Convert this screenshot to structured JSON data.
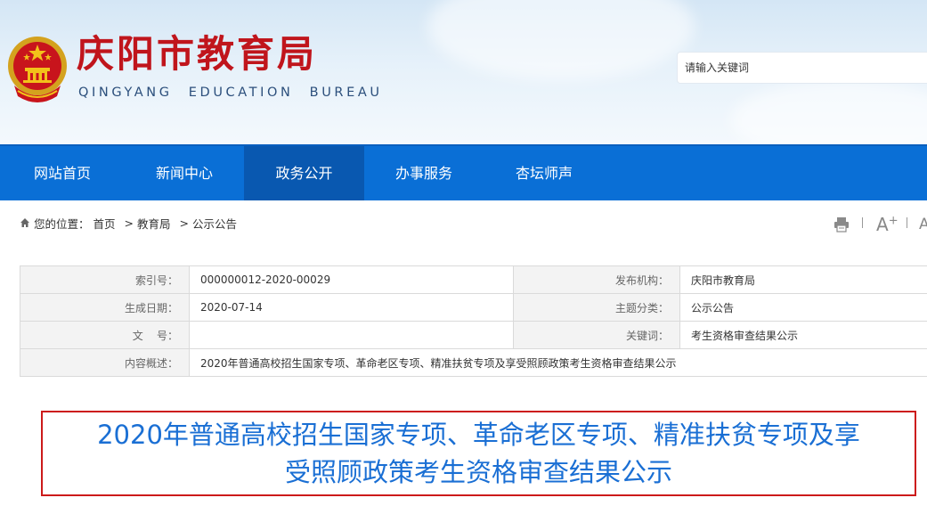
{
  "site": {
    "title": "庆阳市教育局",
    "subtitle": "QINGYANG EDUCATION BUREAU",
    "emblem_icon": "national-emblem-icon",
    "title_color": "#c0151c"
  },
  "search": {
    "placeholder": "请输入关键词"
  },
  "nav": {
    "items": [
      {
        "label": "网站首页"
      },
      {
        "label": "新闻中心"
      },
      {
        "label": "政务公开",
        "active": true
      },
      {
        "label": "办事服务"
      },
      {
        "label": "杏坛师声"
      }
    ],
    "color": "#0a6fd6",
    "active_color": "#0958b0"
  },
  "breadcrumb": {
    "home_icon": "home-icon",
    "prefix": "您的位置：",
    "items": [
      "首页",
      "教育局",
      "公示公告"
    ],
    "separator": ">"
  },
  "tools": {
    "print_icon": "print-icon",
    "font_large": "A",
    "font_large_sign": "+",
    "font_small": "A"
  },
  "meta": {
    "index_label": "索引号：",
    "index_value": "000000012-2020-00029",
    "publisher_label": "发布机构：",
    "publisher_value": "庆阳市教育局",
    "date_label": "生成日期：",
    "date_value": "2020-07-14",
    "category_label": "主题分类：",
    "category_value": "公示公告",
    "docno_label": "文    号：",
    "docno_value": "",
    "keywords_label": "关键词：",
    "keywords_value": "考生资格审查结果公示",
    "summary_label": "内容概述：",
    "summary_value": "2020年普通高校招生国家专项、革命老区专项、精准扶贫专项及享受照顾政策考生资格审查结果公示"
  },
  "article": {
    "title_line1": "2020年普通高校招生国家专项、革命老区专项、精准扶贫专项及享",
    "title_line2": "受照顾政策考生资格审查结果公示",
    "title_color": "#1a6fd4",
    "border_color": "#cc1a1a"
  }
}
